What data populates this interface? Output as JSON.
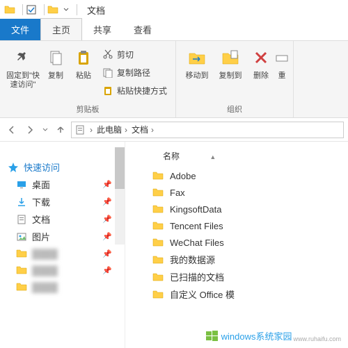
{
  "titlebar": {
    "title": "文档"
  },
  "tabs": {
    "file": "文件",
    "home": "主页",
    "share": "共享",
    "view": "查看"
  },
  "ribbon": {
    "pin": "固定到\"快速访问\"",
    "copy": "复制",
    "paste": "粘贴",
    "cut": "剪切",
    "copy_path": "复制路径",
    "paste_shortcut": "粘贴快捷方式",
    "clipboard_group": "剪贴板",
    "move_to": "移动到",
    "copy_to": "复制到",
    "delete": "删除",
    "rename": "重",
    "organize_group": "组织"
  },
  "breadcrumb": {
    "pc": "此电脑",
    "docs": "文档"
  },
  "nav": {
    "quick_access": "快速访问",
    "desktop": "桌面",
    "downloads": "下载",
    "documents": "文档",
    "pictures": "图片"
  },
  "list": {
    "col_name": "名称",
    "items": [
      "Adobe",
      "Fax",
      "KingsoftData",
      "Tencent Files",
      "WeChat Files",
      "我的数据源",
      "已扫描的文档",
      "自定义 Office 模"
    ]
  },
  "watermark": {
    "text": "windows系统家园",
    "sub": "www.ruhaifu.com"
  }
}
